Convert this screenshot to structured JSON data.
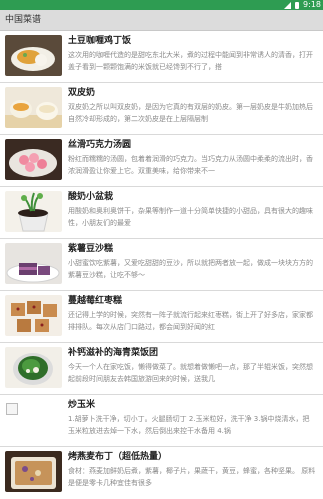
{
  "status": {
    "time": "9:18"
  },
  "header": {
    "title": "中国菜谱"
  },
  "recipes": [
    {
      "title": "土豆咖喱鸡丁饭",
      "desc": "这次用的咖喱代造的是甜吃东北大米，煮的过程中能闻到非常诱人的清香，打开盖子看到一颗颗饱满的米饭就已经馋到不行了，搭"
    },
    {
      "title": "双皮奶",
      "desc": "双皮奶之所以叫双皮奶，是因为它真的有双层的奶皮。第一层奶皮是牛奶加热后自然冷却形成的，第二次奶皮是在上层隔层制"
    },
    {
      "title": "丝滑巧克力汤圆",
      "desc": "粉红而糯糯的汤圆，包着着润滑的巧克力。当巧克力从汤圆中柔柔的流出时，香浓润滑盈让你爱上它。双重美味，给你带来不一"
    },
    {
      "title": "酸奶小盆栽",
      "desc": "用酸奶和奥利奥饼干，杂果等制作一道十分简单快捷的小甜品，具有很大的趣味性，小朋友们的最爱"
    },
    {
      "title": "紫薯豆沙糕",
      "desc": "小甜蜜饮吃紫薯，又爱吃甜甜的豆沙，所以就把两者放一起，做成一块块方方的紫薯豆沙糕，让吃不够～"
    },
    {
      "title": "蔓越莓红枣糕",
      "desc": "还记得上学的时候，突然有一阵子就流行起来红枣糕，街上开了好多店，家家都排排队。每次从店门口路过，都会闻到好闻的红"
    },
    {
      "title": "补钙滋补的海青菜饭团",
      "desc": "今天一个人在家吃饭，懒得做菜了。就想着做懒吧一点，那了半辊米饭，突然想起前段时间朋友去韩国旅游回来的时候，送我几"
    },
    {
      "title": "炒玉米",
      "desc": "1.胡萝卜洗干净，切小丁。火腿肠切丁 2.玉米粒好，洗干净 3.锅中烧清水，把玉米粒放进去焯一下水，然后倒出来控干水备用 4.锅"
    },
    {
      "title": "烤燕麦布丁（超低热量）",
      "desc": "食材：燕麦加鲜奶后煮，紫薯，椰子片，果蔬干，黄豆，蜂蜜，各种坚果。 原料是便是零卡几种宜佳有很多"
    }
  ],
  "colors": {
    "statusbar": "#2e9c52",
    "titlebar": "#dcdcdc"
  }
}
